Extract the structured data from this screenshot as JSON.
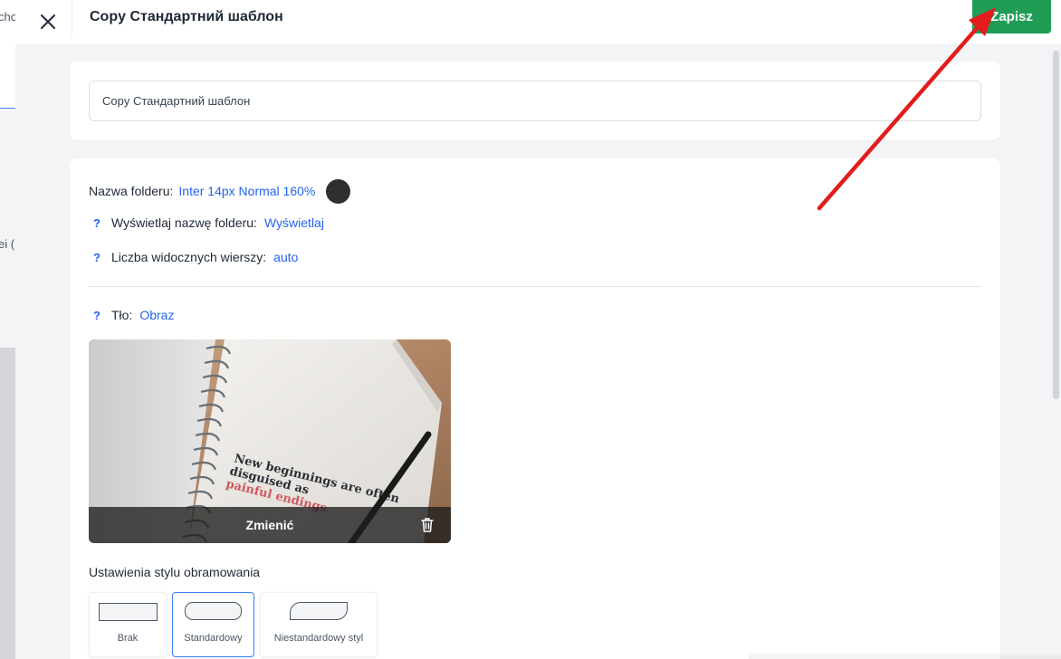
{
  "background_app": {
    "fragment_top": "cho",
    "fragment_mid": "ei ("
  },
  "modal": {
    "title": "Copy Стандартний шаблон",
    "save_label": "Zapisz",
    "save_color": "#1f9d55",
    "accent_color": "#2563eb"
  },
  "name_card": {
    "input_value": "Copy Стандартний шаблон"
  },
  "settings": {
    "folder_name": {
      "label": "Nazwa folderu:",
      "value": "Inter 14px Normal 160%",
      "color": "#2f2f2f"
    },
    "show_folder_name": {
      "help": "?",
      "label": "Wyświetlaj nazwę folderu:",
      "value": "Wyświetlaj"
    },
    "visible_rows": {
      "help": "?",
      "label": "Liczba widocznych wierszy:",
      "value": "auto"
    },
    "background": {
      "help": "?",
      "label": "Tło:",
      "value": "Obraz"
    },
    "image": {
      "text_line1": "New beginnings are often",
      "text_line2": "disguised as",
      "text_line3": "painful endings.",
      "change_label": "Zmienić",
      "delete_icon": "trash-icon"
    },
    "border_style": {
      "title": "Ustawienia stylu obramowania",
      "options": [
        {
          "label": "Brak",
          "selected": false
        },
        {
          "label": "Standardowy",
          "selected": true
        },
        {
          "label": "Niestandardowy styl",
          "selected": false
        }
      ]
    }
  },
  "annotation": {
    "arrow_color": "#e11d1d",
    "points_to": "save-button"
  }
}
